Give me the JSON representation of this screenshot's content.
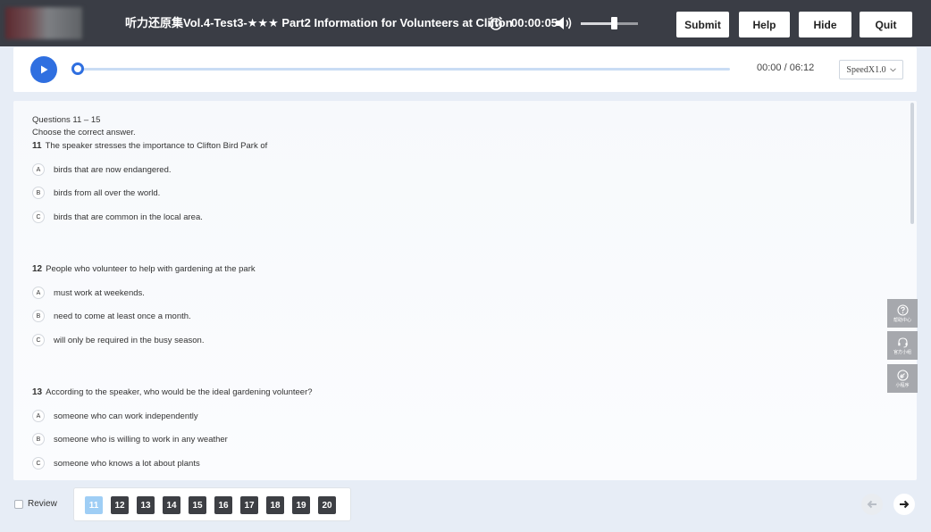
{
  "header": {
    "title": "听力还原集Vol.4-Test3-★★★ Part2 Information for Volunteers at Clifton",
    "timer": "00:00:05",
    "volume_level": 0.58,
    "buttons": {
      "submit": "Submit",
      "help": "Help",
      "hide": "Hide",
      "quit": "Quit"
    }
  },
  "player": {
    "time": "00:00 / 06:12",
    "speed": "SpeedX1.0",
    "progress": 0
  },
  "section": {
    "range": "Questions 11 – 15",
    "instruction": "Choose the correct answer."
  },
  "questions": [
    {
      "number": "11",
      "text": "The speaker stresses the importance to Clifton Bird Park of",
      "options": [
        {
          "letter": "A",
          "text": "birds that are now endangered."
        },
        {
          "letter": "B",
          "text": "birds from all over the world."
        },
        {
          "letter": "C",
          "text": "birds that are common in the local area."
        }
      ]
    },
    {
      "number": "12",
      "text": "People who volunteer to help with gardening at the park",
      "options": [
        {
          "letter": "A",
          "text": "must work at weekends."
        },
        {
          "letter": "B",
          "text": "need to come at least once a month."
        },
        {
          "letter": "C",
          "text": "will only be required in the busy season."
        }
      ]
    },
    {
      "number": "13",
      "text": "According to the speaker, who would be the ideal gardening volunteer?",
      "options": [
        {
          "letter": "A",
          "text": "someone who can work independently"
        },
        {
          "letter": "B",
          "text": "someone who is willing to work in any weather"
        },
        {
          "letter": "C",
          "text": "someone who knows a lot about plants"
        }
      ]
    }
  ],
  "side_tools": [
    {
      "icon": "help-circle-icon",
      "label": "帮助中心"
    },
    {
      "icon": "headset-icon",
      "label": "官方小组"
    },
    {
      "icon": "link-icon",
      "label": "小程序"
    }
  ],
  "footer": {
    "review_label": "Review",
    "question_numbers": [
      "11",
      "12",
      "13",
      "14",
      "15",
      "16",
      "17",
      "18",
      "19",
      "20"
    ],
    "current_question": "11"
  },
  "colors": {
    "accent": "#2f6fe0",
    "topbar": "#3a3d45",
    "current_qnum": "#9fcef5",
    "qnum": "#3d3f44"
  }
}
